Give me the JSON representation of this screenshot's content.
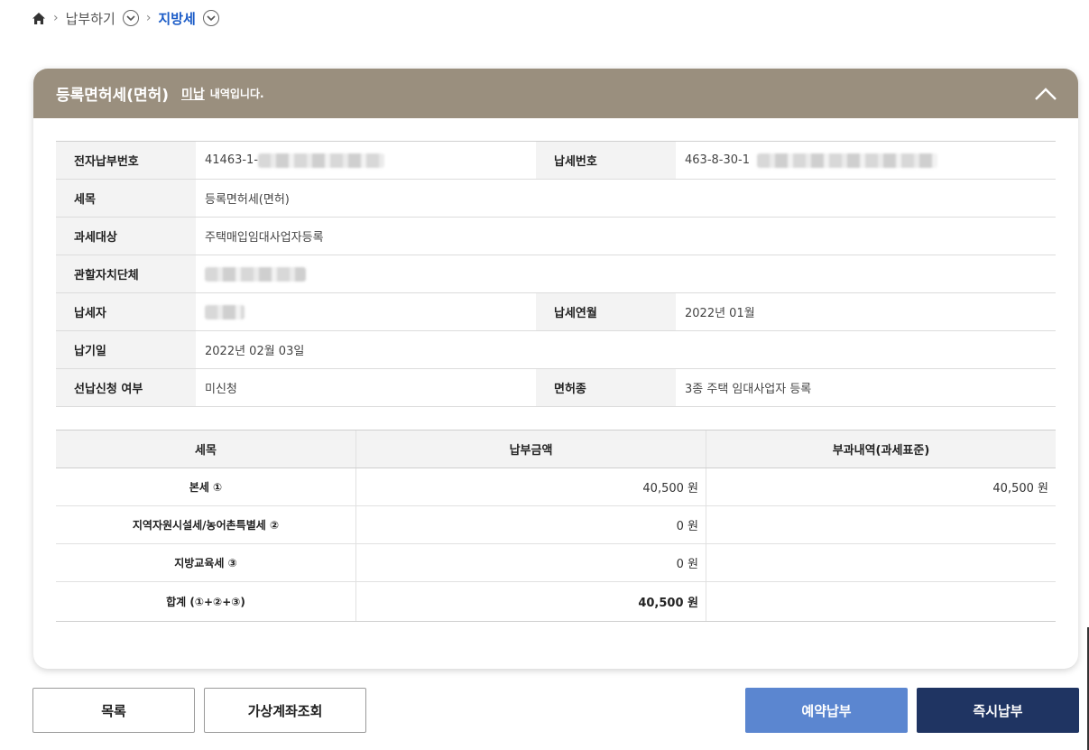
{
  "breadcrumb": {
    "home_icon": "home-icon",
    "items": [
      {
        "label": "납부하기"
      },
      {
        "label": "지방세"
      }
    ]
  },
  "card": {
    "title": "등록면허세(면허)",
    "status": "미납",
    "suffix": "내역입니다.",
    "header_color": "#9a8f7e"
  },
  "info": {
    "electronic_payment_no_label": "전자납부번호",
    "electronic_payment_no_value": "41463-1-",
    "tax_payment_no_label": "납세번호",
    "tax_payment_no_value": "463-8-30-1",
    "tax_item_label": "세목",
    "tax_item_value": "등록면허세(면허)",
    "taxation_object_label": "과세대상",
    "taxation_object_value": "주택매입임대사업자등록",
    "jurisdiction_label": "관할자치단체",
    "jurisdiction_value": "",
    "taxpayer_label": "납세자",
    "taxpayer_value": "",
    "tax_month_label": "납세연월",
    "tax_month_value": "2022년 01월",
    "due_date_label": "납기일",
    "due_date_value": "2022년 02월 03일",
    "prepayment_label": "선납신청 여부",
    "prepayment_value": "미신청",
    "license_type_label": "면허종",
    "license_type_value": "3종 주택 임대사업자 등록"
  },
  "tax_table": {
    "headers": [
      "세목",
      "납부금액",
      "부과내역(과세표준)"
    ],
    "rows": [
      {
        "item": "본세 ①",
        "amount": "40,500 원",
        "assessed": "40,500 원"
      },
      {
        "item": "지역자원시설세/농어촌특별세 ②",
        "amount": "0 원",
        "assessed": ""
      },
      {
        "item": "지방교육세 ③",
        "amount": "0 원",
        "assessed": ""
      },
      {
        "item": "합계 (①+②+③)",
        "amount": "40,500 원",
        "assessed": ""
      }
    ]
  },
  "buttons": {
    "list": "목록",
    "virtual_account": "가상계좌조회",
    "reserve_payment": "예약납부",
    "instant_payment": "즉시납부"
  },
  "colors": {
    "reserve": "#5b86d0",
    "instant": "#1f3462",
    "breadcrumb_active": "#1a5bc7"
  }
}
